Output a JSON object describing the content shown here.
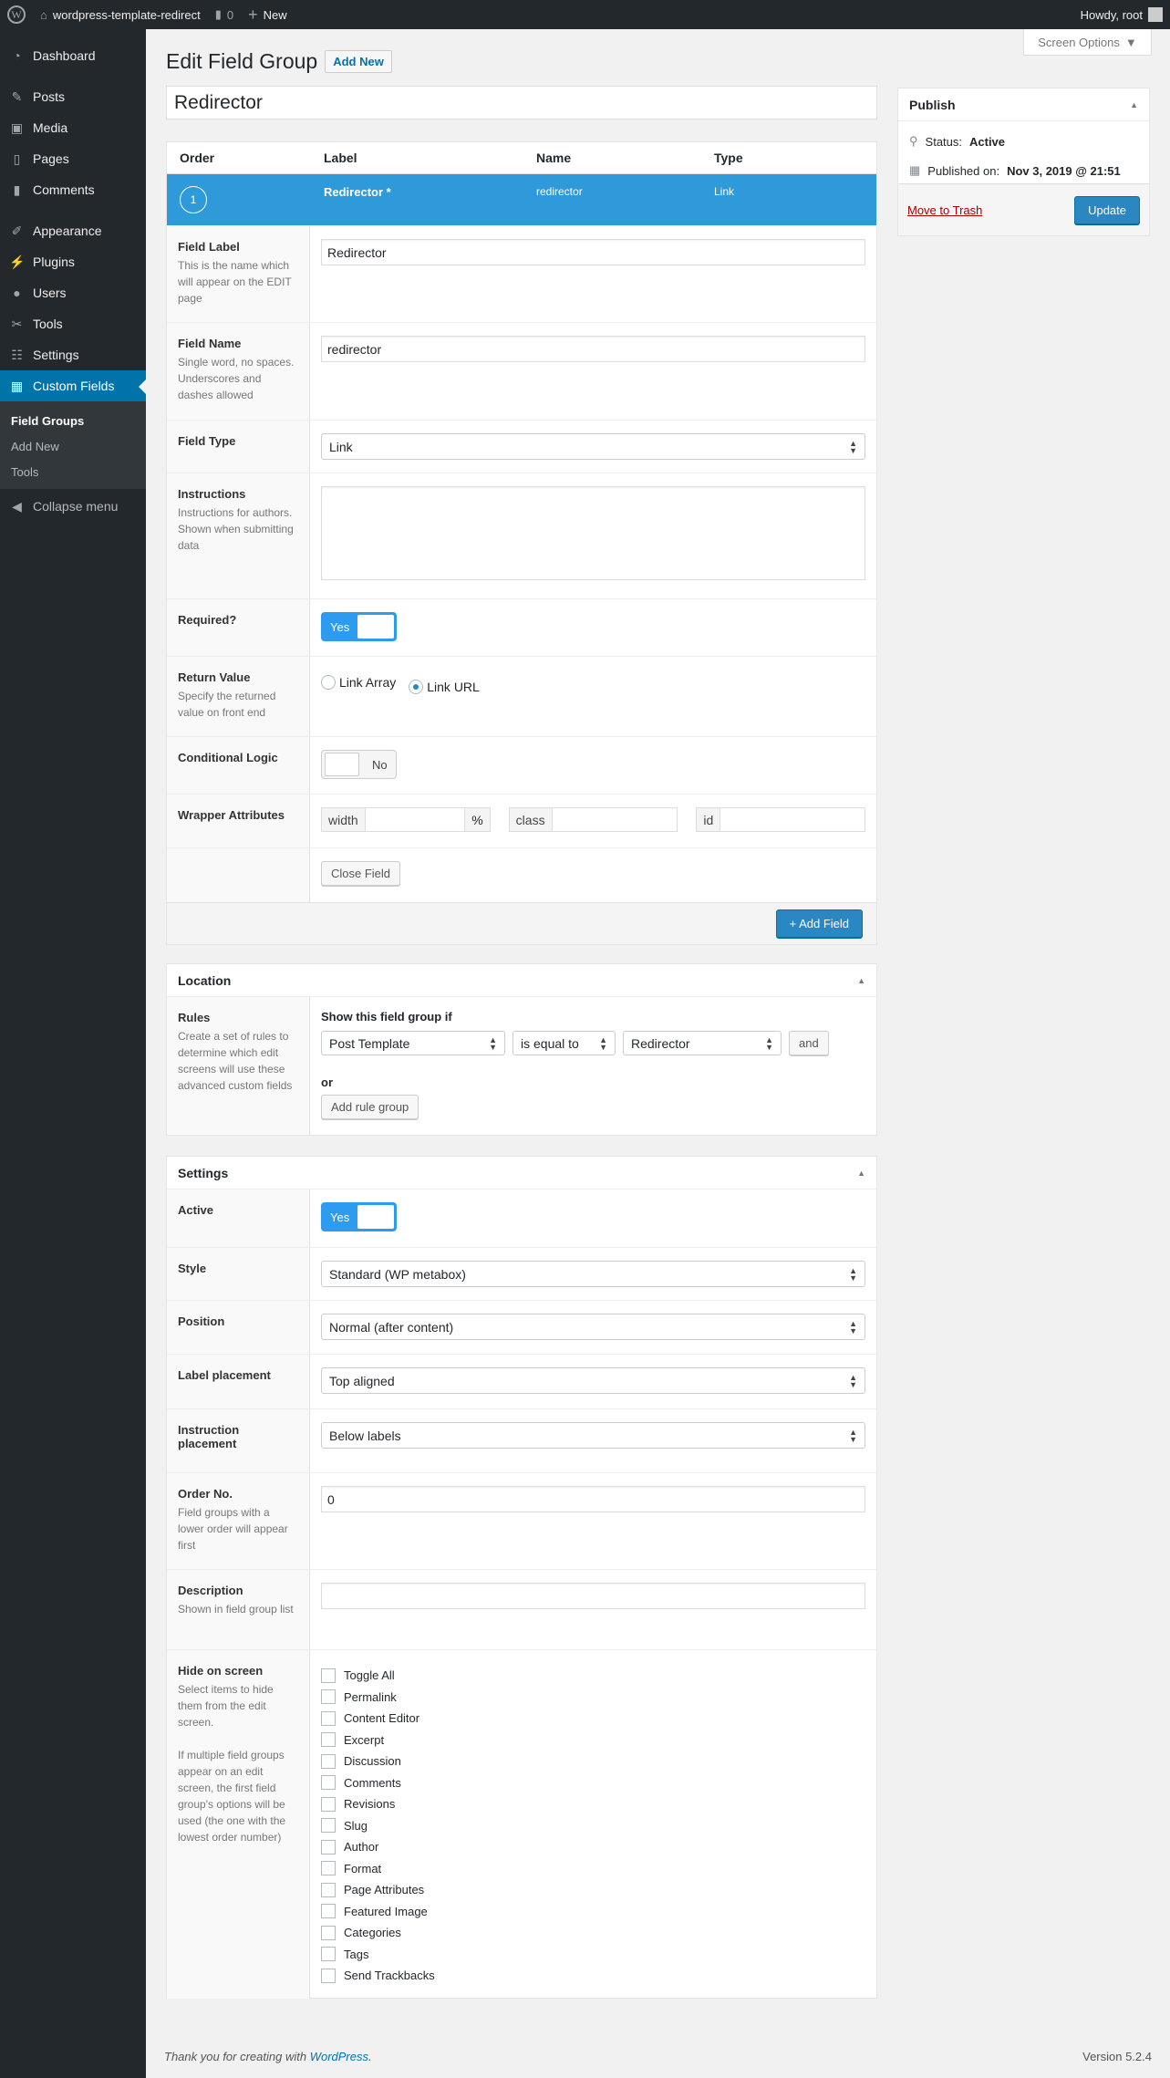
{
  "adminbar": {
    "site": "wordpress-template-redirect",
    "comments": "0",
    "new": "New",
    "howdy": "Howdy, root"
  },
  "sidebar": {
    "items": [
      {
        "label": "Dashboard",
        "icon": "dashboard-icon"
      },
      {
        "label": "Posts",
        "icon": "pin-icon"
      },
      {
        "label": "Media",
        "icon": "media-icon"
      },
      {
        "label": "Pages",
        "icon": "pages-icon"
      },
      {
        "label": "Comments",
        "icon": "comment-icon"
      },
      {
        "label": "Appearance",
        "icon": "brush-icon"
      },
      {
        "label": "Plugins",
        "icon": "plugin-icon"
      },
      {
        "label": "Users",
        "icon": "users-icon"
      },
      {
        "label": "Tools",
        "icon": "wrench-icon"
      },
      {
        "label": "Settings",
        "icon": "settings-icon"
      },
      {
        "label": "Custom Fields",
        "icon": "table-icon"
      }
    ],
    "submenu": [
      "Field Groups",
      "Add New",
      "Tools"
    ],
    "collapse": "Collapse menu"
  },
  "screen_options": "Screen Options",
  "page": {
    "title": "Edit Field Group",
    "add_new": "Add New",
    "group_title": "Redirector"
  },
  "fields": {
    "headers": [
      "Order",
      "Label",
      "Name",
      "Type"
    ],
    "row": {
      "order": "1",
      "label": "Redirector *",
      "name": "redirector",
      "type": "Link"
    },
    "field_label": {
      "label": "Field Label",
      "desc": "This is the name which will appear on the EDIT page",
      "value": "Redirector"
    },
    "field_name": {
      "label": "Field Name",
      "desc": "Single word, no spaces. Underscores and dashes allowed",
      "value": "redirector"
    },
    "field_type": {
      "label": "Field Type",
      "value": "Link"
    },
    "instructions": {
      "label": "Instructions",
      "desc": "Instructions for authors. Shown when submitting data",
      "value": ""
    },
    "required": {
      "label": "Required?",
      "value": "Yes"
    },
    "return_value": {
      "label": "Return Value",
      "desc": "Specify the returned value on front end",
      "options": [
        "Link Array",
        "Link URL"
      ],
      "selected": "Link URL"
    },
    "conditional": {
      "label": "Conditional Logic",
      "value": "No"
    },
    "wrapper": {
      "label": "Wrapper Attributes",
      "width": "width",
      "pct": "%",
      "class": "class",
      "id": "id"
    },
    "close": "Close Field",
    "add": "+ Add Field"
  },
  "location": {
    "title": "Location",
    "rules_label": "Rules",
    "rules_desc": "Create a set of rules to determine which edit screens will use these advanced custom fields",
    "show_if": "Show this field group if",
    "param": "Post Template",
    "operator": "is equal to",
    "value": "Redirector",
    "and": "and",
    "or": "or",
    "add_group": "Add rule group"
  },
  "settings": {
    "title": "Settings",
    "active": {
      "label": "Active",
      "value": "Yes"
    },
    "style": {
      "label": "Style",
      "value": "Standard (WP metabox)"
    },
    "position": {
      "label": "Position",
      "value": "Normal (after content)"
    },
    "label_placement": {
      "label": "Label placement",
      "value": "Top aligned"
    },
    "instruction_placement": {
      "label": "Instruction placement",
      "value": "Below labels"
    },
    "order": {
      "label": "Order No.",
      "desc": "Field groups with a lower order will appear first",
      "value": "0"
    },
    "description": {
      "label": "Description",
      "desc": "Shown in field group list",
      "value": ""
    },
    "hide": {
      "label": "Hide on screen",
      "desc1": "Select items to hide them from the edit screen.",
      "desc2": "If multiple field groups appear on an edit screen, the first field group's options will be used (the one with the lowest order number)",
      "items": [
        "Toggle All",
        "Permalink",
        "Content Editor",
        "Excerpt",
        "Discussion",
        "Comments",
        "Revisions",
        "Slug",
        "Author",
        "Format",
        "Page Attributes",
        "Featured Image",
        "Categories",
        "Tags",
        "Send Trackbacks"
      ]
    }
  },
  "publish": {
    "title": "Publish",
    "status_label": "Status:",
    "status": "Active",
    "published_label": "Published on:",
    "published": "Nov 3, 2019 @ 21:51",
    "trash": "Move to Trash",
    "update": "Update"
  },
  "footer": {
    "thanks": "Thank you for creating with ",
    "link": "WordPress",
    "period": ".",
    "version": "Version 5.2.4"
  }
}
